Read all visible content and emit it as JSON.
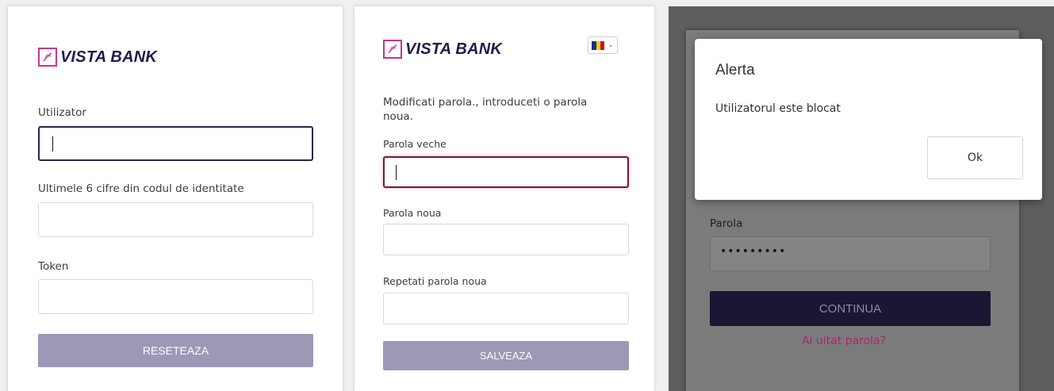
{
  "brand": {
    "name": "VISTA BANK",
    "logo_icon": "leaf-logo-icon",
    "color": "#c8368a",
    "text_color": "#221a4e"
  },
  "reset_panel": {
    "user_label": "Utilizator",
    "id_label": "Ultimele 6 cifre din codul de identitate",
    "token_label": "Token",
    "reset_button": "RESETEAZA"
  },
  "change_panel": {
    "instructions": "Modificati parola., introduceti o parola noua.",
    "old_label": "Parola veche",
    "new_label": "Parola noua",
    "repeat_label": "Repetati parola noua",
    "save_button": "SALVEAZA",
    "language_flag": "romania-flag-icon"
  },
  "login_panel": {
    "password_label": "Parola",
    "password_mask": "•••••••••",
    "continue_button": "CONTINUA",
    "forgot_link": "Ai uitat parola?"
  },
  "alert": {
    "title": "Alerta",
    "message": "Utilizatorul este blocat",
    "ok_button": "Ok"
  }
}
